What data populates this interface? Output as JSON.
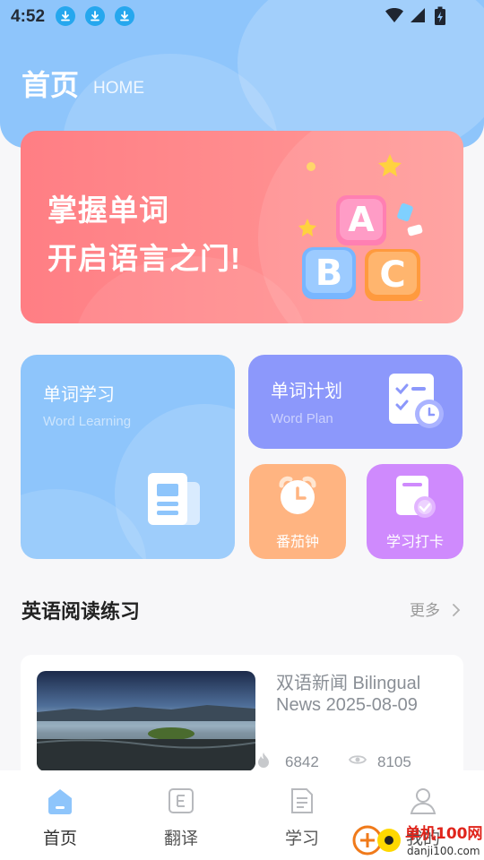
{
  "status_bar": {
    "time": "4:52"
  },
  "header": {
    "title": "首页",
    "subtitle": "HOME"
  },
  "banner": {
    "line1": "掌握单词",
    "line2": "开启语言之门!",
    "blocks": [
      "A",
      "B",
      "C"
    ]
  },
  "features": {
    "word_learning": {
      "title": "单词学习",
      "subtitle": "Word Learning"
    },
    "word_plan": {
      "title": "单词计划",
      "subtitle": "Word Plan"
    },
    "tomato_clock": {
      "label": "番茄钟"
    },
    "study_checkin": {
      "label": "学习打卡"
    }
  },
  "reading": {
    "title": "英语阅读练习",
    "more_label": "更多",
    "articles": [
      {
        "title": "双语新闻 Bilingual News 2025-08-09",
        "likes": "6842",
        "views": "8105"
      }
    ]
  },
  "tabs": [
    {
      "label": "首页",
      "icon": "home-icon"
    },
    {
      "label": "翻译",
      "icon": "translate-icon"
    },
    {
      "label": "学习",
      "icon": "study-icon"
    },
    {
      "label": "我的",
      "icon": "profile-icon"
    }
  ],
  "watermark": {
    "text": "danji100.com"
  },
  "colors": {
    "primary": "#8ec5fb",
    "banner": "#ff8a8f",
    "plan": "#8c98fb",
    "tomato": "#ffb481",
    "checkin": "#cf8afd"
  }
}
